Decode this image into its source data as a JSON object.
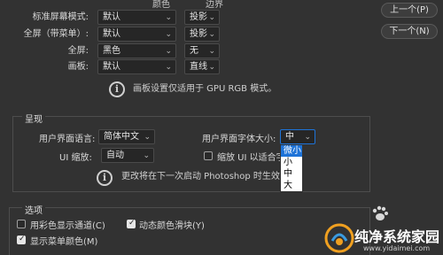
{
  "table": {
    "col_color": "颜色",
    "col_border": "边界",
    "rows": [
      {
        "label": "标准屏幕模式:",
        "color": "默认",
        "border": "投影"
      },
      {
        "label": "全屏（带菜单）:",
        "color": "默认",
        "border": "投影"
      },
      {
        "label": "全屏:",
        "color": "黑色",
        "border": "无"
      },
      {
        "label": "画板:",
        "color": "默认",
        "border": "直线"
      }
    ],
    "note": "画板设置仅适用于 GPU RGB 模式。"
  },
  "buttons": {
    "prev": "上一个(P)",
    "next": "下一个(N)"
  },
  "presentation": {
    "title": "呈现",
    "ui_language_label": "用户界面语言:",
    "ui_language_value": "简体中文",
    "ui_font_size_label": "用户界面字体大小:",
    "ui_font_size_value": "中",
    "ui_scale_label": "UI 缩放:",
    "ui_scale_value": "自动",
    "scale_ui_checkbox": "缩放 UI 以适合字",
    "note": "更改将在下一次启动 Photoshop 时生效"
  },
  "font_size_options": [
    {
      "label": "微小",
      "selected": true
    },
    {
      "label": "小",
      "selected": false
    },
    {
      "label": "中",
      "selected": false
    },
    {
      "label": "大",
      "selected": false
    }
  ],
  "options": {
    "title": "选项",
    "color_channels": "用彩色显示通道(C)",
    "dynamic_sliders": "动态颜色滑块(Y)",
    "menu_colors": "显示菜单颜色(M)",
    "color_channels_checked": false,
    "dynamic_sliders_checked": true,
    "menu_colors_checked": true
  },
  "watermark": {
    "title": "纯净系统家园",
    "url": "www.yidaimei.com"
  },
  "colors": {
    "background": "#323232",
    "selection": "#1e73d8",
    "watermark_orange": "#f0a020"
  }
}
